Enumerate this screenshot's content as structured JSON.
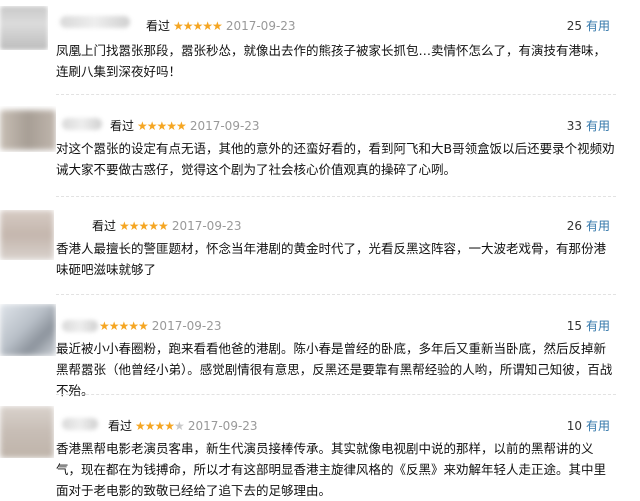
{
  "reviews": [
    {
      "seen": "看过",
      "stars": "★★★★★",
      "stars_off": "",
      "date": "2017-09-23",
      "votes": "25",
      "useful": "有用",
      "text": "凤凰上门找嚣张那段，嚣张秒怂，就像出去作的熊孩子被家长抓包…卖情怀怎么了，有演技有港味，连刷八集到深夜好吗！"
    },
    {
      "seen": "看过",
      "stars": "★★★★★",
      "stars_off": "",
      "date": "2017-09-23",
      "votes": "33",
      "useful": "有用",
      "text": "对这个嚣张的设定有点无语，其他的意外的还蛮好看的，看到阿飞和大B哥领盒饭以后还要录个视频劝诫大家不要做古惑仔，觉得这个剧为了社会核心价值观真的操碎了心咧。"
    },
    {
      "seen": "看过",
      "stars": "★★★★★",
      "stars_off": "",
      "date": "2017-09-23",
      "votes": "26",
      "useful": "有用",
      "text": "香港人最擅长的警匪题材，怀念当年港剧的黄金时代了，光看反黑这阵容，一大波老戏骨，有那份港味砸吧滋味就够了"
    },
    {
      "seen": "看过",
      "stars": "★★★★★",
      "stars_off": "",
      "date": "2017-09-23",
      "votes": "15",
      "useful": "有用",
      "text": "最近被小小春圈粉，跑来看看他爸的港剧。陈小春是曾经的卧底，多年后又重新当卧底，然后反掉新黑帮嚣张（他曾经小弟）。感觉剧情很有意思，反黑还是要靠有黑帮经验的人哟，所谓知己知彼，百战不殆。"
    },
    {
      "seen": "看过",
      "stars": "★★★★",
      "stars_off": "★",
      "date": "2017-09-23",
      "votes": "10",
      "useful": "有用",
      "text": "香港黑帮电影老演员客串，新生代演员接棒传承。其实就像电视剧中说的那样，以前的黑帮讲的义气，现在都在为钱搏命，所以才有这部明显香港主旋律风格的《反黑》来劝解年轻人走正途。其中里面对于老电影的致敬已经给了追下去的足够理由。"
    }
  ]
}
